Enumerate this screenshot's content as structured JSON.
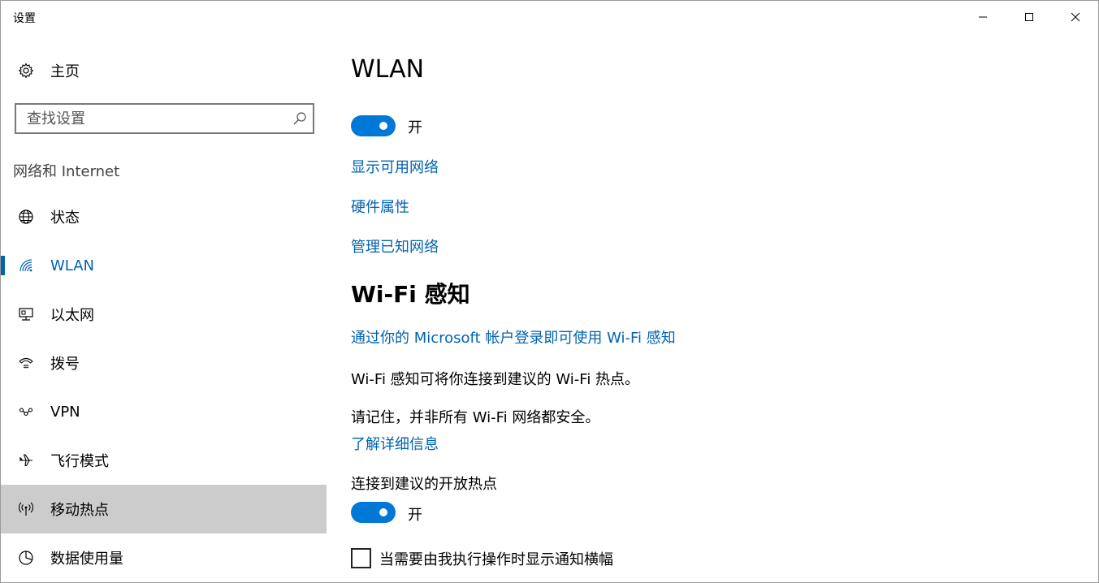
{
  "window": {
    "title": "设置"
  },
  "sidebar": {
    "home_label": "主页",
    "search_placeholder": "查找设置",
    "section_label": "网络和 Internet",
    "items": [
      {
        "label": "状态",
        "icon": "globe-icon"
      },
      {
        "label": "WLAN",
        "icon": "wifi-icon",
        "active": true
      },
      {
        "label": "以太网",
        "icon": "ethernet-icon"
      },
      {
        "label": "拨号",
        "icon": "dialup-icon"
      },
      {
        "label": "VPN",
        "icon": "vpn-icon"
      },
      {
        "label": "飞行模式",
        "icon": "airplane-icon"
      },
      {
        "label": "移动热点",
        "icon": "hotspot-icon",
        "hovered": true
      },
      {
        "label": "数据使用量",
        "icon": "data-usage-icon"
      }
    ]
  },
  "main": {
    "title": "WLAN",
    "wlan_toggle": {
      "state": "on",
      "label": "开"
    },
    "links": {
      "show_networks": "显示可用网络",
      "hardware_props": "硬件属性",
      "manage_known": "管理已知网络"
    },
    "wifi_sense": {
      "title": "Wi-Fi 感知",
      "signin_link": "通过你的 Microsoft 帐户登录即可使用 Wi-Fi 感知",
      "desc": "Wi-Fi 感知可将你连接到建议的 Wi-Fi 热点。",
      "warning": "请记住，并非所有 Wi-Fi 网络都安全。",
      "learn_more": "了解详细信息",
      "connect_label": "连接到建议的开放热点",
      "connect_toggle": {
        "state": "on",
        "label": "开"
      },
      "notify_checkbox": {
        "checked": false,
        "label": "当需要由我执行操作时显示通知横幅"
      }
    }
  },
  "colors": {
    "accent": "#0078d7",
    "link": "#0063b1",
    "hover_bg": "#cccccc"
  }
}
